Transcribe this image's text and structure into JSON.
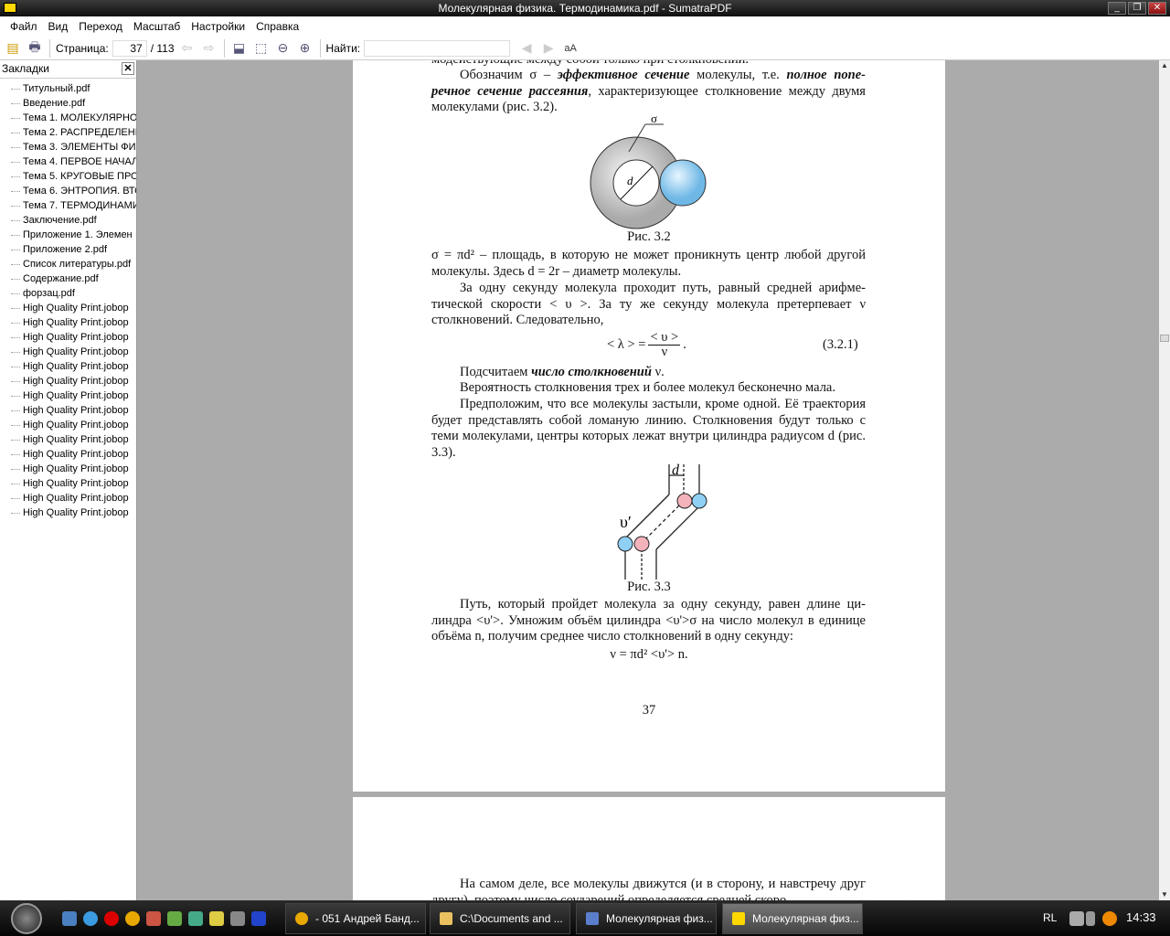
{
  "window": {
    "title": "Молекулярная физика. Термодинамика.pdf - SumatraPDF",
    "icon": "PDF"
  },
  "menu": [
    "Файл",
    "Вид",
    "Переход",
    "Масштаб",
    "Настройки",
    "Справка"
  ],
  "toolbar": {
    "page_label": "Страница:",
    "page_value": "37",
    "page_total": "/ 113",
    "find_label": "Найти:",
    "find_value": "",
    "find_case_icon": "aA"
  },
  "sidebar": {
    "title": "Закладки",
    "close": "✕",
    "items": [
      "Титульный.pdf",
      "Введение.pdf",
      "Тема 1. МОЛЕКУЛЯРНО-",
      "Тема 2. РАСПРЕДЕЛЕНИ",
      "Тема 3. ЭЛЕМЕНТЫ ФИЗИ",
      "Тема 4. ПЕРВОЕ НАЧАЛО",
      "Тема 5.  КРУГОВЫЕ ПРО",
      "Тема 6. ЭНТРОПИЯ. ВТО",
      "Тема 7. ТЕРМОДИНАМИ",
      "Заключение.pdf",
      "Приложение 1. Элемен",
      "Приложение 2.pdf",
      "Список литературы.pdf",
      "Содержание.pdf",
      "форзац.pdf",
      "High Quality Print.jobop",
      "High Quality Print.jobop",
      "High Quality Print.jobop",
      "High Quality Print.jobop",
      "High Quality Print.jobop",
      "High Quality Print.jobop",
      "High Quality Print.jobop",
      "High Quality Print.jobop",
      "High Quality Print.jobop",
      "High Quality Print.jobop",
      "High Quality Print.jobop",
      "High Quality Print.jobop",
      "High Quality Print.jobop",
      "High Quality Print.jobop",
      "High Quality Print.jobop"
    ]
  },
  "doc": {
    "top_cut": "модействующие между собой только при столкновении.",
    "p1": {
      "a": "Обозначим σ – ",
      "b": "эффективное сечение",
      "c": " молекулы, т.е. ",
      "d": "полное попе­речное сечение рассеяния",
      "e": ", характеризующее столкновение между дву­мя молекулами (рис. 3.2)."
    },
    "fig32": {
      "sigma": "σ",
      "d": "d",
      "caption": "Рис. 3.2"
    },
    "p2": "σ = πd² – площадь, в которую не может проникнуть центр любой дру­гой молекулы. Здесь d = 2r – диаметр молекулы.",
    "p3": "За одну секунду молекула проходит путь, равный средней арифме­тической скорости < υ >. За ту же секунду молекула претерпевает ν столкновений. Следовательно,",
    "eq1": {
      "lhs": "< λ > =",
      "num": "< υ >",
      "den": "ν",
      "dot": ".",
      "num_label": "(3.2.1)"
    },
    "p4": {
      "a": "Подсчитаем ",
      "b": "число столкновений",
      "c": " ν."
    },
    "p5": "Вероятность столкновения трех и более молекул бесконечно мала.",
    "p6": "Предположим, что все молекулы застыли, кроме одной. Её траек­тория будет представлять собой ломаную линию. Столкновения будут только с теми молекулами, центры которых лежат внутри цилиндра ра­диусом d (рис. 3.3).",
    "fig33": {
      "d": "d",
      "v": "υ′",
      "caption": "Рис. 3.3"
    },
    "p7": "Путь, который пройдет молекула за одну секунду, равен длине ци­линдра <υ'>. Умножим объём цилиндра <υ'>σ на число молекул в единице объёма n, получим среднее число столкновений в одну секунду:",
    "eq2": "ν = πd² <υ'> n.",
    "page_number": "37",
    "p8": "На самом деле, все молекулы движутся (и в сторону, и навстречу друг другу), поэтому число соударений определяется средней скоро­"
  },
  "taskbar": {
    "tasks": [
      "- 051 Андрей Банд...",
      "C:\\Documents and ...",
      "Молекулярная физ...",
      "Молекулярная физ..."
    ],
    "lang": "RL",
    "clock": "14:33"
  }
}
